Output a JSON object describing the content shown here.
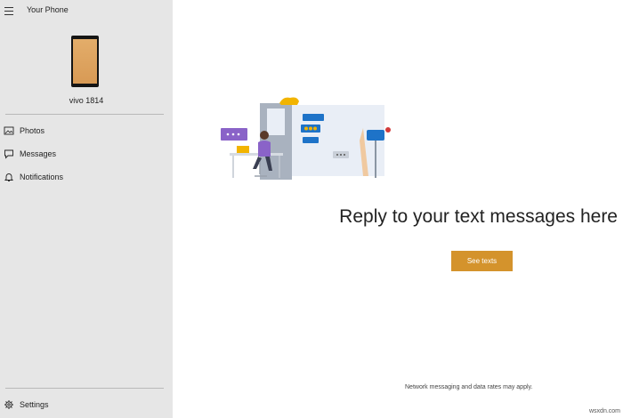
{
  "window": {
    "title": "Your Phone"
  },
  "device": {
    "name": "vivo 1814"
  },
  "sidebar": {
    "items": [
      {
        "label": "Photos",
        "icon": "photo-icon"
      },
      {
        "label": "Messages",
        "icon": "message-icon"
      },
      {
        "label": "Notifications",
        "icon": "bell-icon"
      }
    ],
    "settings": {
      "label": "Settings",
      "icon": "gear-icon"
    }
  },
  "main": {
    "headline": "Reply to your text messages here",
    "button_label": "See texts",
    "footnote": "Network messaging and data rates may apply."
  },
  "watermark": "wsxdn.com",
  "colors": {
    "sidebar_bg": "#e6e6e6",
    "accent": "#d4932c",
    "bubble_blue": "#1e73c8",
    "bubble_purple": "#8a63c8"
  }
}
